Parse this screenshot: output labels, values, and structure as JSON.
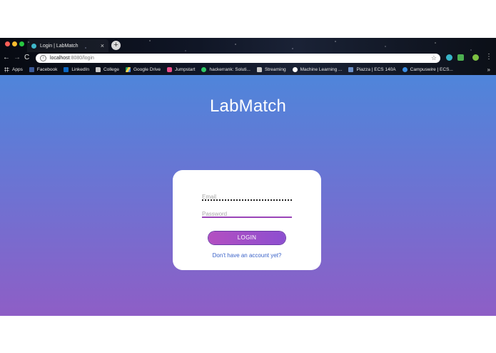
{
  "browser": {
    "tab": {
      "title": "Login | LabMatch",
      "close_glyph": "×"
    },
    "new_tab_glyph": "+",
    "nav": {
      "back": "←",
      "forward": "→",
      "reload": "C"
    },
    "address": {
      "host": "localhost",
      "path": ":8080/login",
      "info_glyph": "i",
      "star_glyph": "☆"
    },
    "menu_glyph": "⋮",
    "bookmarks": [
      {
        "label": "Apps",
        "icon": "apps-grid-icon"
      },
      {
        "label": "Facebook",
        "icon": "facebook-icon"
      },
      {
        "label": "LinkedIn",
        "icon": "linkedin-icon"
      },
      {
        "label": "College",
        "icon": "folder-icon"
      },
      {
        "label": "Google Drive",
        "icon": "google-drive-icon"
      },
      {
        "label": "Jumpstart",
        "icon": "jumpstart-icon"
      },
      {
        "label": "hackerrank: Soluti...",
        "icon": "hackerrank-icon"
      },
      {
        "label": "Streaming",
        "icon": "folder-icon"
      },
      {
        "label": "Machine Learning ...",
        "icon": "ml-icon"
      },
      {
        "label": "Piazza | ECS 140A",
        "icon": "piazza-icon"
      },
      {
        "label": "Campuswire | ECS...",
        "icon": "campuswire-icon"
      }
    ],
    "bookmarks_overflow": "»"
  },
  "page": {
    "brand": "LabMatch",
    "form": {
      "email_placeholder": "Email",
      "password_placeholder": "Password",
      "login_label": "LOGIN",
      "signup_link": "Don't have an account yet?"
    }
  },
  "colors": {
    "gradient_top": "#4f85da",
    "gradient_bottom": "#8e5ec6",
    "button_start": "#b34fc1",
    "button_end": "#8d4fd0",
    "link": "#3a62c8",
    "password_underline": "#9a45b8"
  }
}
